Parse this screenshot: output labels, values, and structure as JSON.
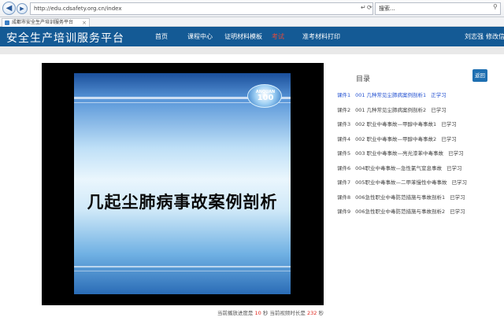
{
  "browser": {
    "url": "http://edu.cdsafety.org.cn/index",
    "search_text": "搜索...",
    "tab_title": "成都市安全生产培训服务平台"
  },
  "header": {
    "brand": "安全生产培训服务平台",
    "menu": [
      {
        "label": "首页",
        "active": false
      },
      {
        "label": "课程中心",
        "active": false
      },
      {
        "label": "证明材料模板",
        "active": false
      },
      {
        "label": "考试",
        "active": true
      },
      {
        "label": "准考材料打印",
        "active": false
      }
    ],
    "user_name": "刘志强",
    "change_password": "修改信"
  },
  "video": {
    "logo_text": "ANQUAN",
    "logo_number": "100",
    "slide_title": "几起尘肺病事故案例剖析"
  },
  "progress": {
    "prefix": "当前播放进度是",
    "current": "10",
    "mid": "秒 当前视频时长是",
    "total": "232",
    "suffix": "秒"
  },
  "toc": {
    "title": "目录",
    "back_label": "返回",
    "items": [
      {
        "label": "课件1",
        "title": "001 几种常见尘肺病案例剖析1",
        "status": "正学习",
        "current": true
      },
      {
        "label": "课件2",
        "title": "001 几种常见尘肺病案例剖析2",
        "status": "已学习",
        "current": false
      },
      {
        "label": "课件3",
        "title": "002 职业中毒事故—甲醇中毒事故1",
        "status": "已学习",
        "current": false
      },
      {
        "label": "课件4",
        "title": "002 职业中毒事故—甲醇中毒事故2",
        "status": "已学习",
        "current": false
      },
      {
        "label": "课件5",
        "title": "003 职业中毒事故—亮光漆苯中毒事故",
        "status": "已学习",
        "current": false
      },
      {
        "label": "课件6",
        "title": "004职业中毒事故—急性氯气窒息事故",
        "status": "已学习",
        "current": false
      },
      {
        "label": "课件7",
        "title": "005职业中毒事故—二甲苯慢性中毒事故",
        "status": "已学习",
        "current": false
      },
      {
        "label": "课件8",
        "title": "006急性职业中毒防范措施与事故剖析1",
        "status": "已学习",
        "current": false
      },
      {
        "label": "课件9",
        "title": "006急性职业中毒防范措施与事故剖析2",
        "status": "已学习",
        "current": false
      }
    ]
  }
}
